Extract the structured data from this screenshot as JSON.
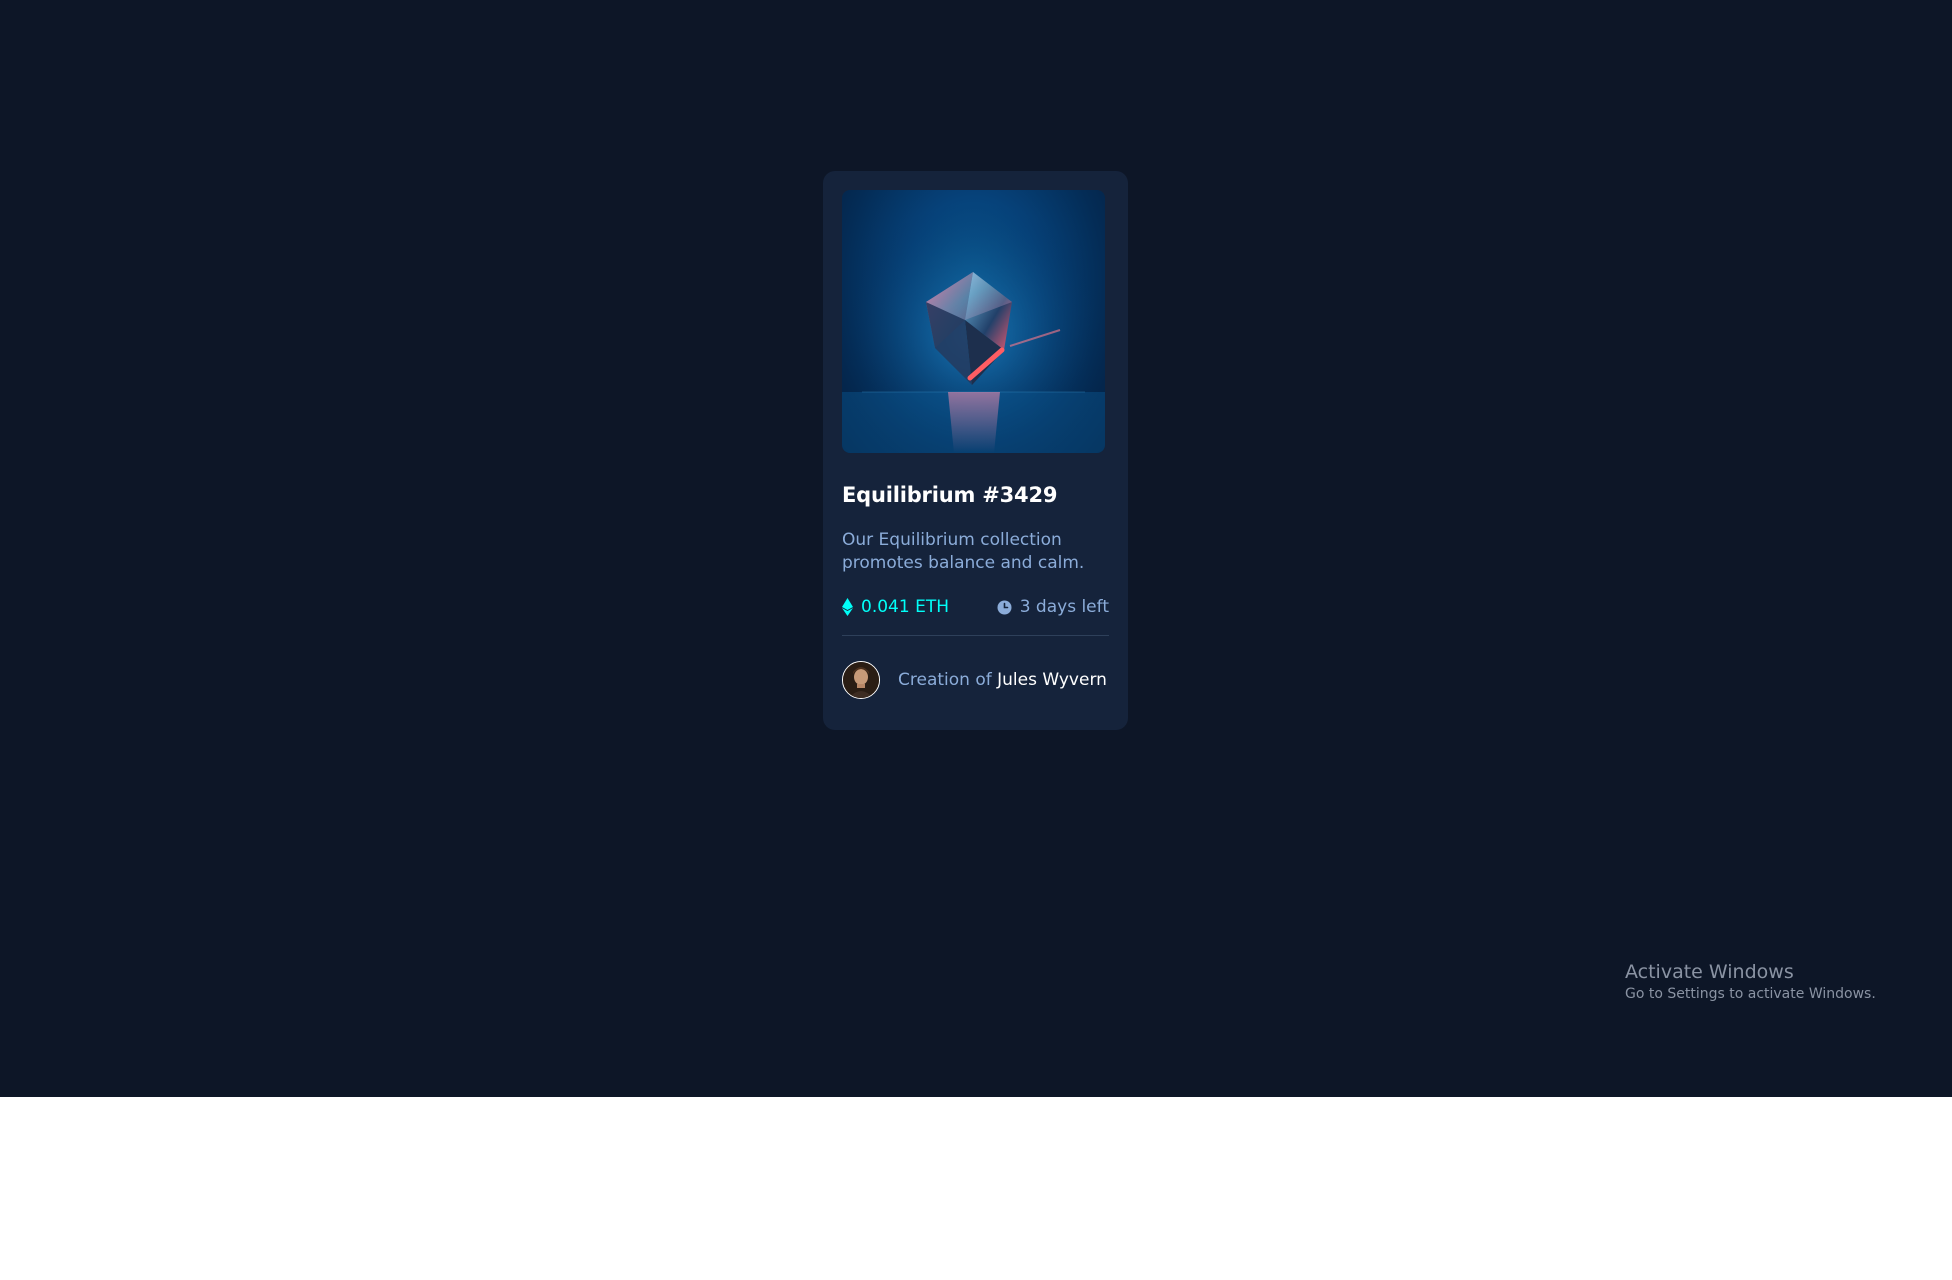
{
  "card": {
    "title": "Equilibrium #3429",
    "description": "Our Equilibrium collection promotes balance and calm.",
    "price": "0.041 ETH",
    "time_left": "3 days left",
    "creator_prefix": "Creation of",
    "creator_name": "Jules Wyvern"
  },
  "icons": {
    "price": "ethereum-icon",
    "time": "clock-icon"
  },
  "colors": {
    "page_background": "#0d1627",
    "card_background": "#15233b",
    "accent_cyan": "#00fff8",
    "soft_blue": "#8bacd9",
    "white": "#ffffff"
  },
  "watermark": {
    "title": "Activate Windows",
    "subtitle": "Go to Settings to activate Windows."
  }
}
